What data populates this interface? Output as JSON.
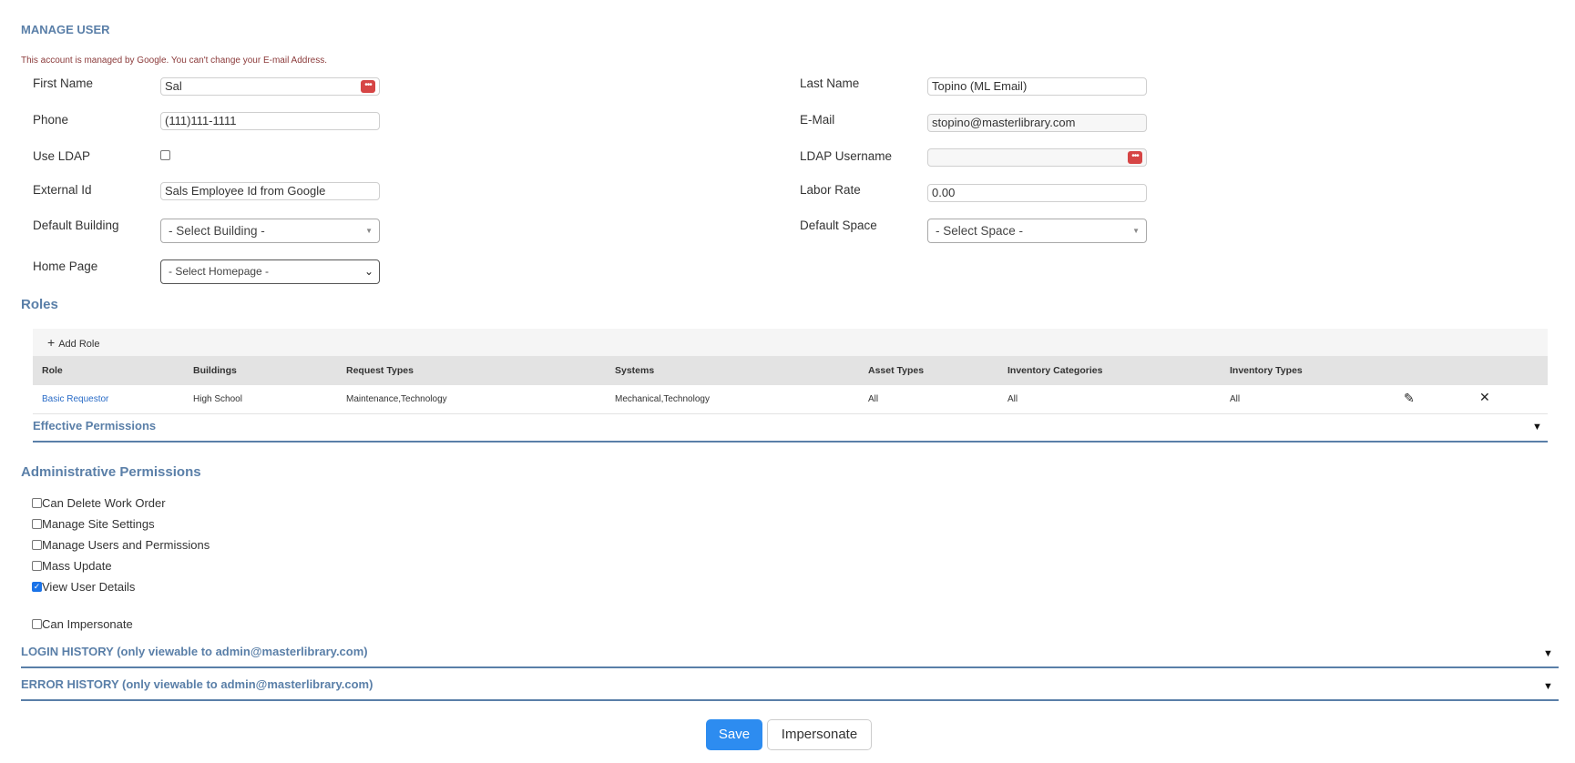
{
  "page_title": "MANAGE USER",
  "notice": "This account is managed by Google. You can't change your E-mail Address.",
  "fields": {
    "first_name": {
      "label": "First Name",
      "value": "Sal"
    },
    "last_name": {
      "label": "Last Name",
      "value": "Topino (ML Email)"
    },
    "phone": {
      "label": "Phone",
      "value": "(111)111-1111"
    },
    "email": {
      "label": "E-Mail",
      "value": "stopino@masterlibrary.com"
    },
    "use_ldap": {
      "label": "Use LDAP"
    },
    "ldap_username": {
      "label": "LDAP Username",
      "value": ""
    },
    "external_id": {
      "label": "External Id",
      "value": "Sals Employee Id from Google"
    },
    "labor_rate": {
      "label": "Labor Rate",
      "value": "0.00"
    },
    "default_building": {
      "label": "Default Building",
      "value": "- Select Building -"
    },
    "default_space": {
      "label": "Default Space",
      "value": "- Select Space -"
    },
    "home_page": {
      "label": "Home Page",
      "value": "- Select Homepage -"
    }
  },
  "roles": {
    "title": "Roles",
    "add_label": "Add Role",
    "columns": [
      "Role",
      "Buildings",
      "Request Types",
      "Systems",
      "Asset Types",
      "Inventory Categories",
      "Inventory Types"
    ],
    "rows": [
      [
        "Basic Requestor",
        "High School",
        "Maintenance,Technology",
        "Mechanical,Technology",
        "All",
        "All",
        "All"
      ]
    ],
    "effective_permissions": "Effective Permissions"
  },
  "admin": {
    "title": "Administrative Permissions",
    "items": [
      {
        "label": "Can Delete Work Order",
        "checked": false
      },
      {
        "label": "Manage Site Settings",
        "checked": false
      },
      {
        "label": "Manage Users and Permissions",
        "checked": false
      },
      {
        "label": "Mass Update",
        "checked": false
      },
      {
        "label": "View User Details",
        "checked": true
      }
    ],
    "impersonate": {
      "label": "Can Impersonate",
      "checked": false
    }
  },
  "login_history": "LOGIN HISTORY (only viewable to admin@masterlibrary.com)",
  "error_history": "ERROR HISTORY (only viewable to admin@masterlibrary.com)",
  "buttons": {
    "save": "Save",
    "impersonate": "Impersonate"
  },
  "colors": {
    "accent": "#5a7fa8",
    "primary_button": "#2d8cf0",
    "notice": "#8b3a3a",
    "link": "#2a6cc7"
  }
}
